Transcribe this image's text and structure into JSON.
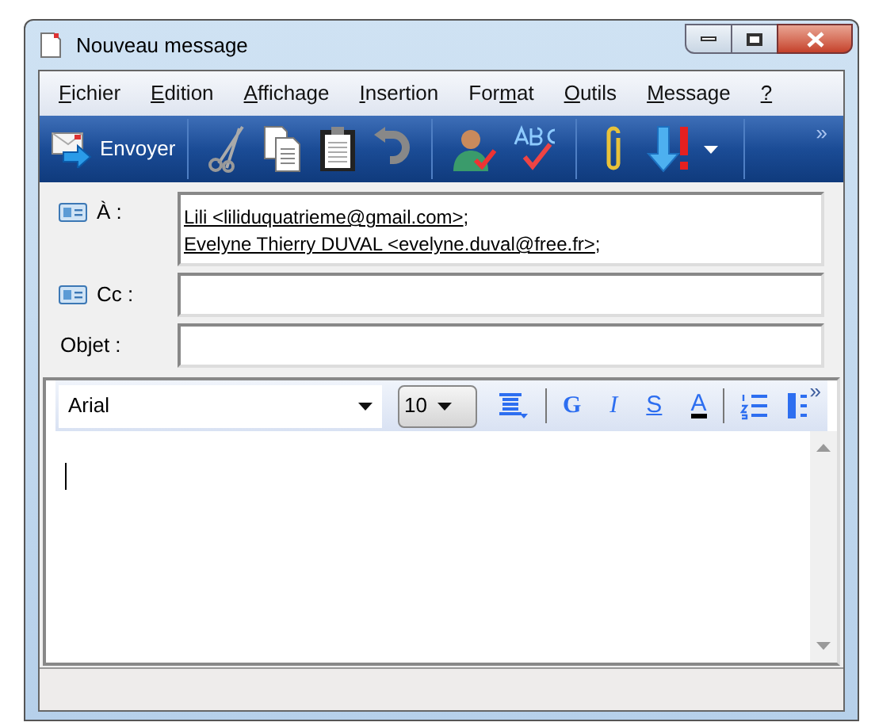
{
  "window": {
    "title": "Nouveau message"
  },
  "menu": [
    {
      "accel": "F",
      "rest": "ichier"
    },
    {
      "accel": "E",
      "rest": "dition"
    },
    {
      "accel": "A",
      "rest": "ffichage"
    },
    {
      "accel": "I",
      "rest": "nsertion"
    },
    {
      "before": "For",
      "accel": "m",
      "rest": "at"
    },
    {
      "accel": "O",
      "rest": "utils"
    },
    {
      "accel": "M",
      "rest": "essage"
    },
    {
      "accel": "?"
    }
  ],
  "toolbar": {
    "send": "Envoyer",
    "more": "»"
  },
  "to": {
    "label": "À :",
    "recipients": [
      {
        "text": "Lili <liliduquatrieme@gmail.com>",
        "sep": ";"
      },
      {
        "text": "Evelyne Thierry DUVAL <evelyne.duval@free.fr>",
        "sep": ";"
      }
    ]
  },
  "cc": {
    "label": "Cc :"
  },
  "subject": {
    "label": "Objet :"
  },
  "format_bar": {
    "font": "Arial",
    "size": "10",
    "more": "»",
    "buttons": [
      {
        "kind": "bold",
        "text": "G"
      },
      {
        "kind": "italic",
        "text": "I"
      },
      {
        "kind": "underline",
        "text": "S"
      },
      {
        "kind": "color",
        "text": "A"
      }
    ]
  }
}
